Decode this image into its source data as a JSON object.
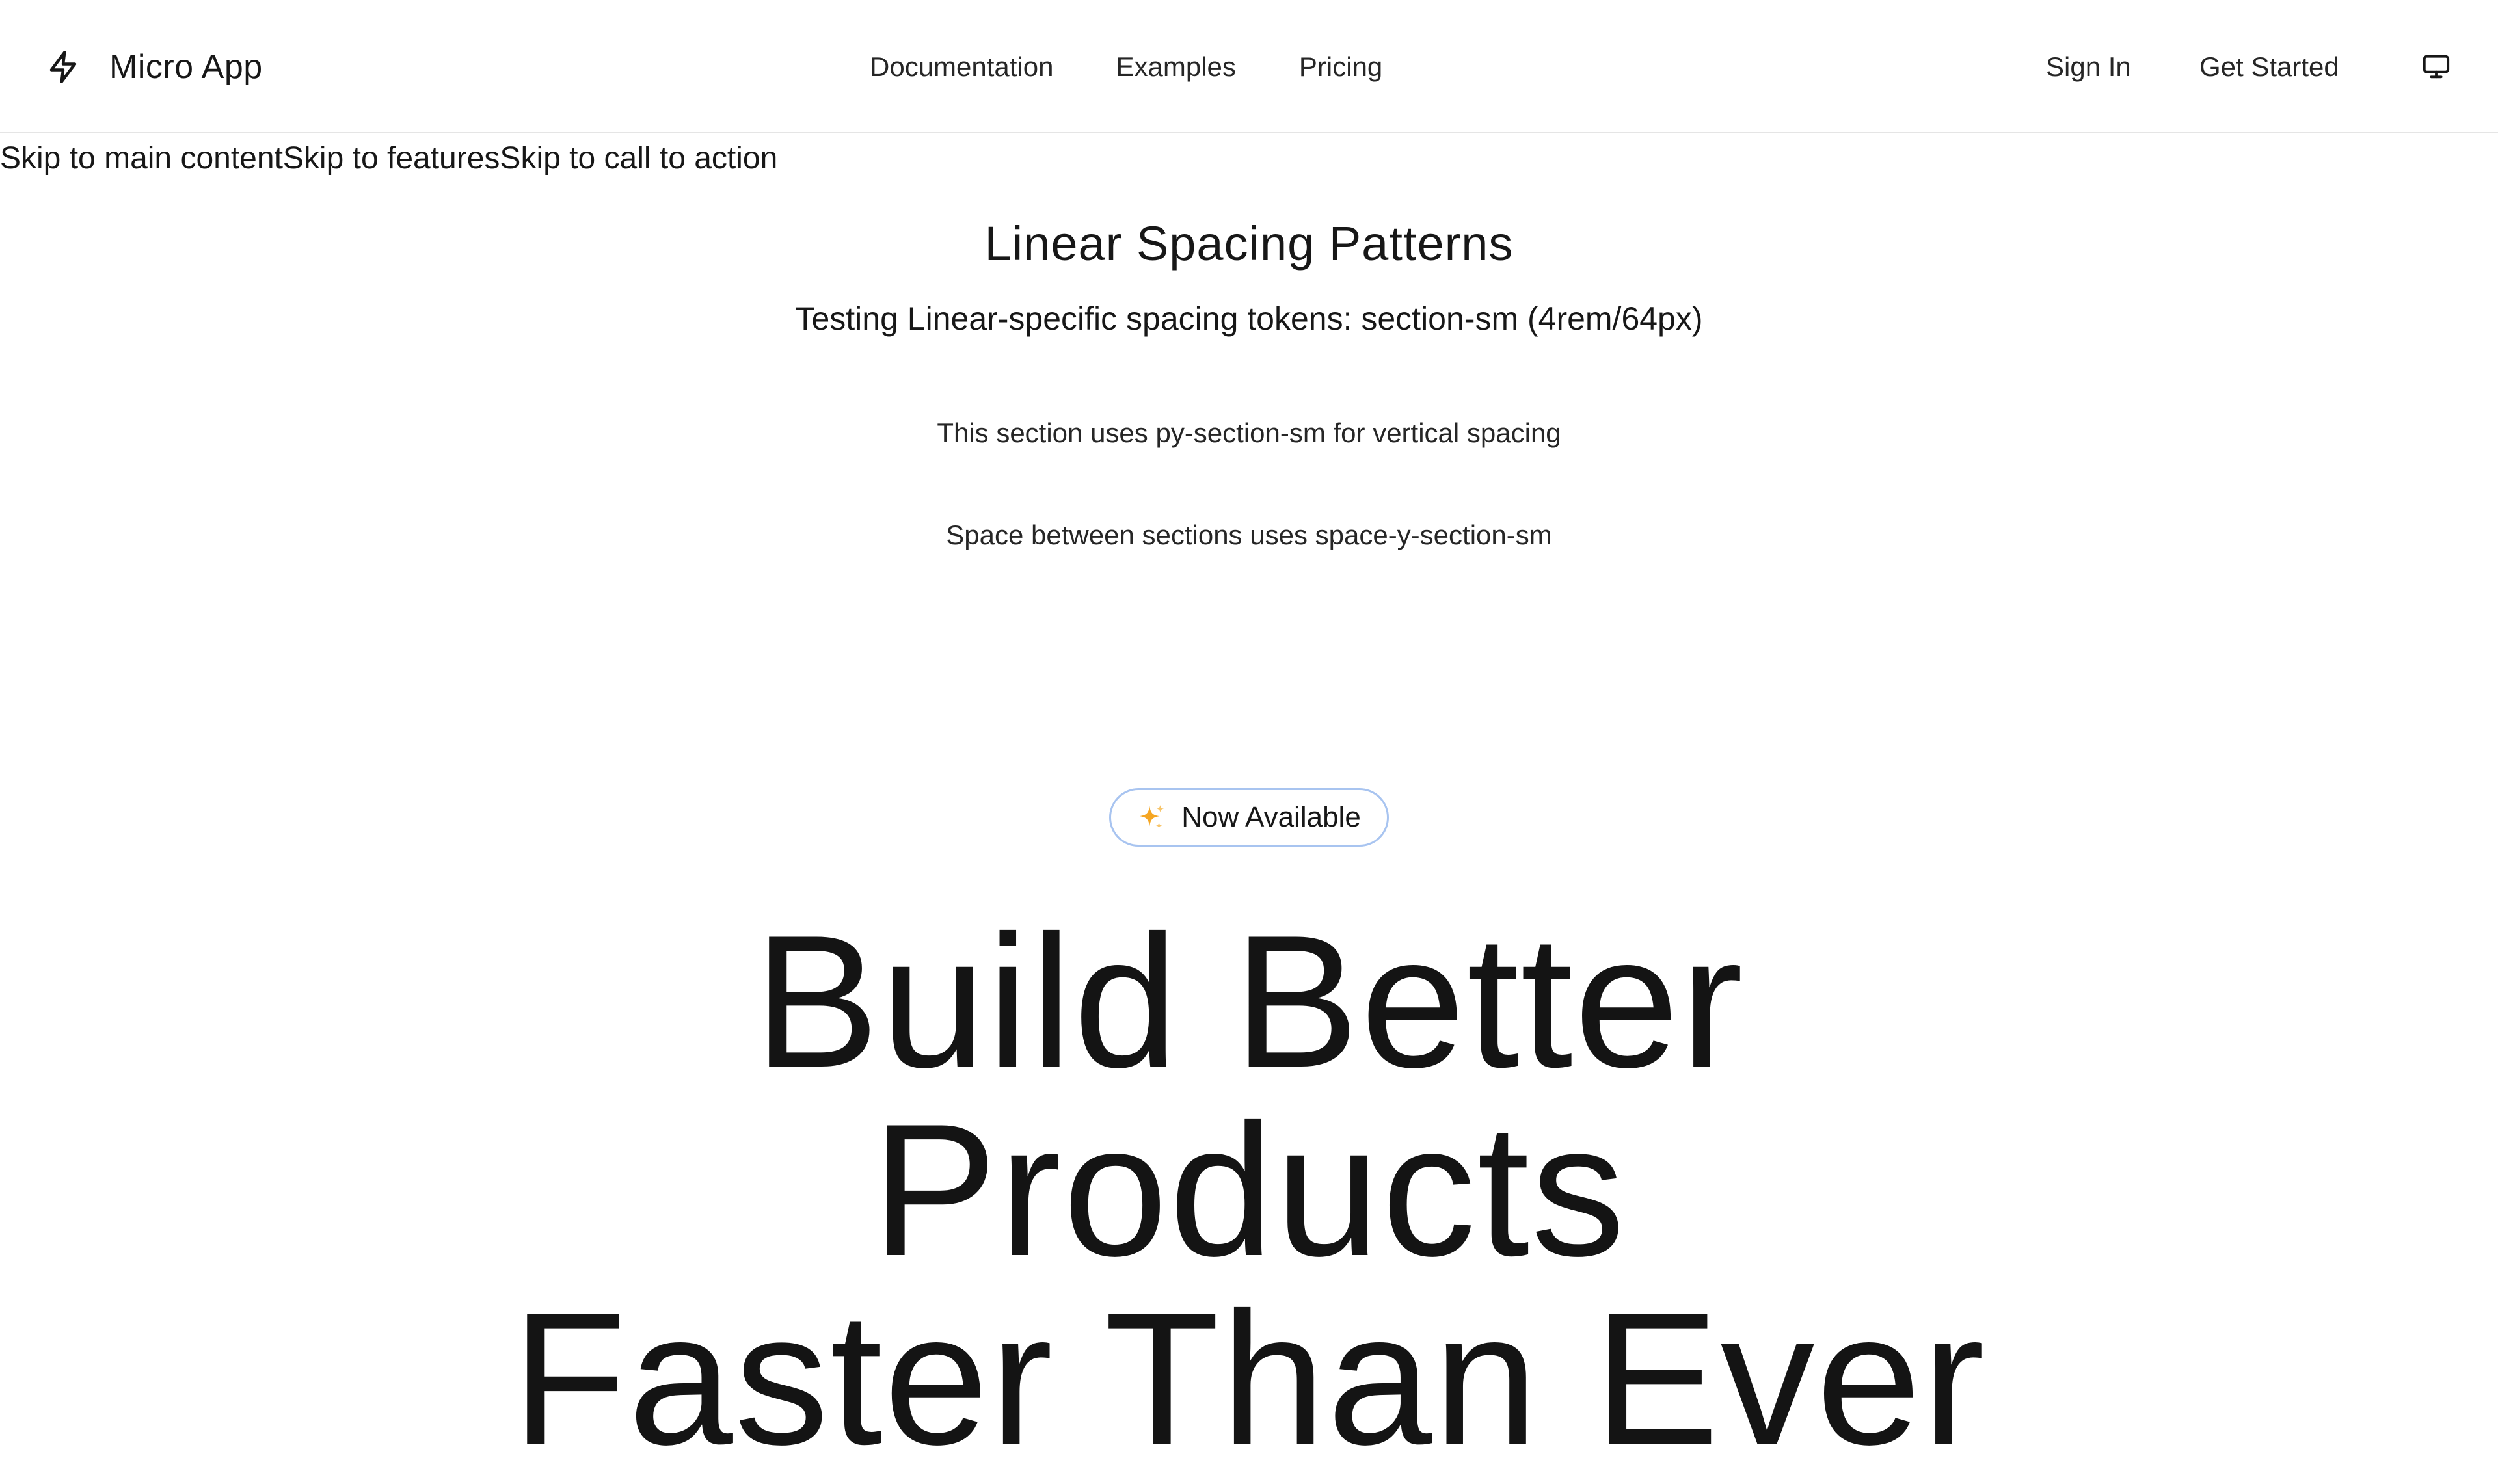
{
  "header": {
    "brand_name": "Micro App",
    "brand_icon": "lightning-bolt-icon",
    "nav": [
      {
        "label": "Documentation"
      },
      {
        "label": "Examples"
      },
      {
        "label": "Pricing"
      }
    ],
    "sign_in_label": "Sign In",
    "get_started_label": "Get Started",
    "theme_icon": "monitor-icon"
  },
  "skip_links": [
    {
      "label": "Skip to main content"
    },
    {
      "label": "Skip to features"
    },
    {
      "label": "Skip to call to action"
    }
  ],
  "spacing_section": {
    "title": "Linear Spacing Patterns",
    "subtitle": "Testing Linear-specific spacing tokens: section-sm (4rem/64px)",
    "note_1": "This section uses py-section-sm for vertical spacing",
    "note_2": "Space between sections uses space-y-section-sm"
  },
  "hero": {
    "badge_icon": "sparkles-icon",
    "badge_label": "Now Available",
    "title_lines": [
      "Build Better",
      "Products",
      "Faster Than Ever"
    ]
  },
  "colors": {
    "text": "#171717",
    "border": "#e5e5e5",
    "badge_border": "#a8c4f0",
    "sparkle_primary": "#f5a623",
    "sparkle_secondary": "#f7c56b"
  }
}
